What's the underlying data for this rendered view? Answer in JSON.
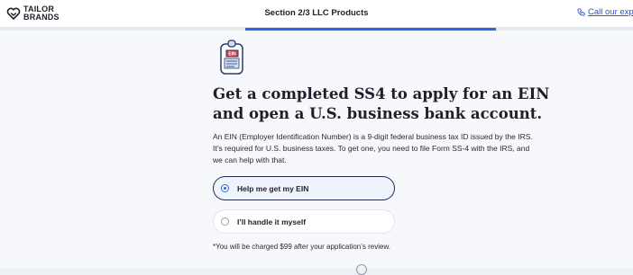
{
  "header": {
    "logo_line1": "TAILOR",
    "logo_line2": "BRANDS",
    "section_title": "Section 2/3 LLC Products",
    "call_text": "Call our expe"
  },
  "progress": {
    "active_segment": 2
  },
  "main": {
    "icon_text": "EIN",
    "heading": "Get a completed SS4 to apply for an EIN and open a U.S. business bank account.",
    "description": "An EIN (Employer Identification Number) is a 9-digit federal business tax ID issued by the IRS. It’s required for U.S. business taxes. To get one, you need to file Form SS-4 with the IRS, and we can help with that.",
    "options": [
      {
        "label": "Help me get my EIN",
        "selected": true
      },
      {
        "label": "I’ll handle it myself",
        "selected": false
      }
    ],
    "note": "*You will be charged $99 after your application’s review."
  },
  "colors": {
    "accent": "#2c64e3",
    "link": "#2a55d4",
    "text": "#1f1f2b",
    "icon_red": "#e0404a"
  }
}
